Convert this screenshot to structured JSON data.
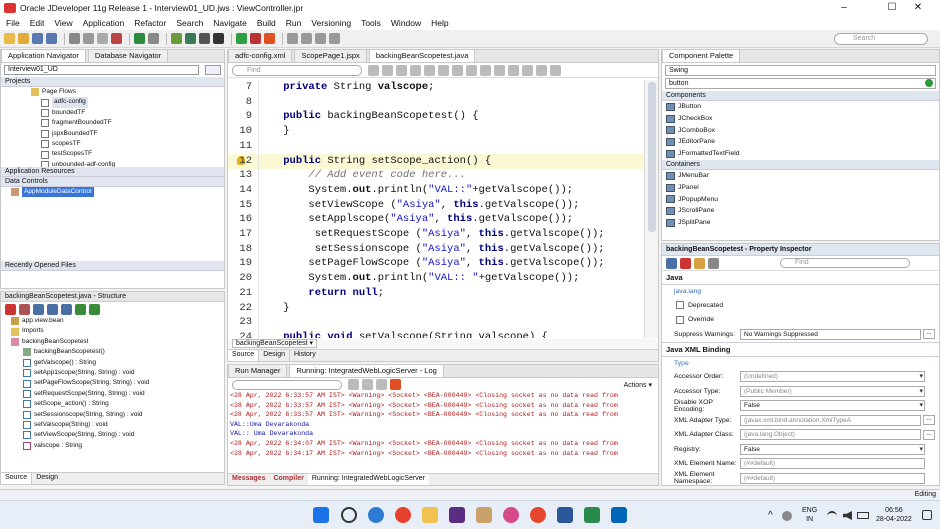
{
  "window": {
    "title": "Oracle JDeveloper 11g Release 1 - Interview01_UD.jws : ViewController.jpr",
    "controls": [
      "–",
      "☐",
      "✕"
    ]
  },
  "menu": [
    "File",
    "Edit",
    "View",
    "Application",
    "Refactor",
    "Search",
    "Navigate",
    "Build",
    "Run",
    "Versioning",
    "Tools",
    "Window",
    "Help"
  ],
  "toolbar": {
    "search_placeholder": "Search"
  },
  "app_nav": {
    "tabs": [
      "Application Navigator",
      "Database Navigator"
    ],
    "app_select": "Interview01_UD",
    "projects_label": "Projects",
    "tree": [
      "Page Flows",
      "adfc-config",
      "boundedTF",
      "fragmentBoundedTF",
      "jspxBoundedTF",
      "scopesTF",
      "testScopesTF",
      "unbounded-adf-config"
    ],
    "sections": [
      "Application Resources",
      "Data Controls",
      "Recently Opened Files"
    ],
    "data_control": "AppModuleDataControl"
  },
  "structure": {
    "title": "backingBeanScopetest.java - Structure",
    "items": [
      "app.view.bean",
      "Imports",
      "backingBeanScopetest",
      "backingBeanScopetest()",
      "getValscope() : String",
      "setApp1scope(String, String) : void",
      "setPageFlowScope(String, String) : void",
      "setRequestScope(String, String) : void",
      "setScope_action() : String",
      "setSessionscope(String, String) : void",
      "setValscope(String) : void",
      "setViewScope(String, String) : void",
      "valscope : String"
    ],
    "bottom_tabs": [
      "Source",
      "Design"
    ]
  },
  "editor": {
    "tabs": [
      "adfc-config.xml",
      "ScopePage1.jspx",
      "backingBeanScopetest.java"
    ],
    "find_placeholder": "Find",
    "line_numbers": [
      "7",
      "8",
      "9",
      "10",
      "11",
      "12",
      "13",
      "14",
      "15",
      "16",
      "17",
      "18",
      "19",
      "20",
      "21",
      "22",
      "23",
      "24"
    ],
    "breadcrumb": "backingBeanScopetest ▾",
    "bottom_tabs": [
      "Source",
      "Design",
      "History"
    ],
    "lines": [
      [
        [
          "    ",
          ""
        ],
        [
          "private",
          "kw-plain"
        ],
        [
          " String ",
          ""
        ],
        [
          "valscope",
          "bold"
        ],
        [
          ";",
          ""
        ]
      ],
      [
        [
          "",
          ""
        ]
      ],
      [
        [
          "    ",
          ""
        ],
        [
          "public",
          "kw-plain"
        ],
        [
          " backingBeanScopetest() {",
          ""
        ]
      ],
      [
        [
          "    }",
          ""
        ]
      ],
      [
        [
          "",
          ""
        ]
      ],
      [
        [
          "    ",
          ""
        ],
        [
          "public",
          "kw-plain"
        ],
        [
          " String setScope_action() {",
          ""
        ]
      ],
      [
        [
          "        ",
          ""
        ],
        [
          "// Add event code here...",
          "cmt"
        ]
      ],
      [
        [
          "        System.",
          ""
        ],
        [
          "out",
          "bold"
        ],
        [
          ".println(",
          ""
        ],
        [
          "\"VAL::\"",
          "str"
        ],
        [
          "+getValscope());",
          ""
        ]
      ],
      [
        [
          "        setViewScope (",
          ""
        ],
        [
          "\"Asiya\"",
          "str"
        ],
        [
          ", ",
          ""
        ],
        [
          "this",
          "kw"
        ],
        [
          ".getValscope());",
          ""
        ]
      ],
      [
        [
          "        setApplscope(",
          ""
        ],
        [
          "\"Asiya\"",
          "str"
        ],
        [
          ", ",
          ""
        ],
        [
          "this",
          "kw"
        ],
        [
          ".getValscope());",
          ""
        ]
      ],
      [
        [
          "         setRequestScope (",
          ""
        ],
        [
          "\"Asiya\"",
          "str"
        ],
        [
          ", ",
          ""
        ],
        [
          "this",
          "kw"
        ],
        [
          ".getValscope());",
          ""
        ]
      ],
      [
        [
          "         setSessionscope (",
          ""
        ],
        [
          "\"Asiya\"",
          "str"
        ],
        [
          ", ",
          ""
        ],
        [
          "this",
          "kw"
        ],
        [
          ".getValscope());",
          ""
        ]
      ],
      [
        [
          "        setPageFlowScope (",
          ""
        ],
        [
          "\"Asiya\"",
          "str"
        ],
        [
          ", ",
          ""
        ],
        [
          "this",
          "kw"
        ],
        [
          ".getValscope());",
          ""
        ]
      ],
      [
        [
          "        System.",
          ""
        ],
        [
          "out",
          "bold"
        ],
        [
          ".println(",
          ""
        ],
        [
          "\"VAL:: \"",
          "str"
        ],
        [
          "+getValscope());",
          ""
        ]
      ],
      [
        [
          "        ",
          ""
        ],
        [
          "return null",
          "kw"
        ],
        [
          ";",
          ""
        ]
      ],
      [
        [
          "    }",
          ""
        ]
      ],
      [
        [
          "",
          ""
        ]
      ],
      [
        [
          "    ",
          ""
        ],
        [
          "public void",
          "kw-plain"
        ],
        [
          " setValscope(String valscope) {",
          ""
        ]
      ]
    ]
  },
  "log": {
    "tabs": [
      "Run Manager",
      "Running: IntegratedWebLogicServer - Log"
    ],
    "actions_label": "Actions ▾",
    "lines": [
      [
        "<28 Apr, 2022 6:33:57 AM IST> <Warning> <Socket> <BEA-000449> <Closing socket as no data read from",
        "red"
      ],
      [
        "<28 Apr, 2022 6:33:57 AM IST> <Warning> <Socket> <BEA-000449> <Closing socket as no data read from",
        "red"
      ],
      [
        "<28 Apr, 2022 6:33:57 AM IST> <Warning> <Socket> <BEA-000449> <Closing socket as no data read from",
        "red"
      ],
      [
        "VAL::Uma Devarakonda",
        "blk"
      ],
      [
        "VAL:: Uma Devarakonda",
        "blk"
      ],
      [
        "<28 Apr, 2022 6:34:07 AM IST> <Warning> <Socket> <BEA-000449> <Closing socket as no data read from",
        "red"
      ],
      [
        "<28 Apr, 2022 6:34:17 AM IST> <Warning> <Socket> <BEA-000449> <Closing socket as no data read from",
        "red"
      ]
    ],
    "bottom_tabs": [
      "Messages",
      "Compiler",
      "Running: IntegratedWebLogicServer"
    ]
  },
  "palette": {
    "title": "Component Palette",
    "library": "Swing",
    "search_value": "button",
    "group_components": "Components",
    "components": [
      "JButton",
      "JCheckBox",
      "JComboBox",
      "JEditorPane",
      "JFormattedTextField"
    ],
    "group_containers": "Containers",
    "containers": [
      "JMenuBar",
      "JPanel",
      "JPopupMenu",
      "JScrollPane",
      "JSplitPane"
    ]
  },
  "inspector": {
    "title": "backingBeanScopetest - Property Inspector",
    "find_placeholder": "Find",
    "java_section": "Java",
    "package": "java.lang",
    "deprecated": "Deprecated",
    "override": "Override",
    "suppress_label": "Suppress Warnings:",
    "suppress_value": "No Warnings Suppressed",
    "binding_section": "Java XML Binding",
    "type_label": "Type",
    "rows": [
      [
        "Accessor Order:",
        "(Undefined)"
      ],
      [
        "Accessor Type:",
        "(Public Member)"
      ],
      [
        "Disable XOP Encoding:",
        "False"
      ],
      [
        "XML Adapter Type:",
        "(javax.xml.bind.annotation.XmlTypeA"
      ],
      [
        "XML Adapter Class:",
        "(java.lang.Object)"
      ],
      [
        "Registry:",
        "False"
      ],
      [
        "XML Element Name:",
        "(##default)"
      ],
      [
        "XML Element Namespace:",
        "(##default)"
      ]
    ]
  },
  "status": {
    "right": "Editing"
  },
  "taskbar": {
    "lang": "ENG",
    "region": "IN",
    "time": "06:56",
    "date": "28-04-2022"
  },
  "colors": {
    "accent": "#3b6cb7",
    "selection": "#3875d7",
    "current_line": "#fbf8d6"
  }
}
